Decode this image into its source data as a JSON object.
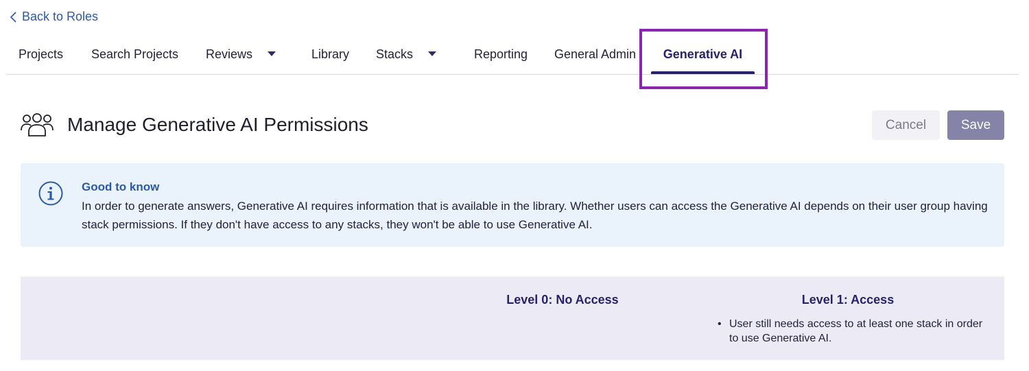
{
  "nav": {
    "back_label": "Back to Roles"
  },
  "tabs": [
    {
      "label": "Projects",
      "has_dropdown": false,
      "active": false
    },
    {
      "label": "Search Projects",
      "has_dropdown": false,
      "active": false
    },
    {
      "label": "Reviews",
      "has_dropdown": true,
      "active": false
    },
    {
      "label": "Library",
      "has_dropdown": false,
      "active": false
    },
    {
      "label": "Stacks",
      "has_dropdown": true,
      "active": false
    },
    {
      "label": "Reporting",
      "has_dropdown": false,
      "active": false
    },
    {
      "label": "General Admin",
      "has_dropdown": false,
      "active": false
    },
    {
      "label": "Generative AI",
      "has_dropdown": false,
      "active": true
    }
  ],
  "header": {
    "icon": "user-group-icon",
    "title": "Manage Generative AI Permissions",
    "cancel_label": "Cancel",
    "save_label": "Save"
  },
  "info": {
    "icon": "info-circle-icon",
    "title": "Good to know",
    "body": "In order to generate answers, Generative AI requires information that is available in the library. Whether users can access the Generative AI depends on their user group having stack permissions. If they don't have access to any stacks, they won't be able to use Generative AI."
  },
  "levels": [
    {
      "title": "Level 0: No Access",
      "notes": []
    },
    {
      "title": "Level 1: Access",
      "notes": [
        "User still needs access to at least one stack in order to use Generative AI."
      ]
    }
  ],
  "colors": {
    "accent": "#27216e",
    "link": "#2b5aa8",
    "highlight": "#8b24b0",
    "save_button": "#8583a8",
    "info_bg": "#eaf2fb",
    "levels_bg": "#ecebf5"
  }
}
